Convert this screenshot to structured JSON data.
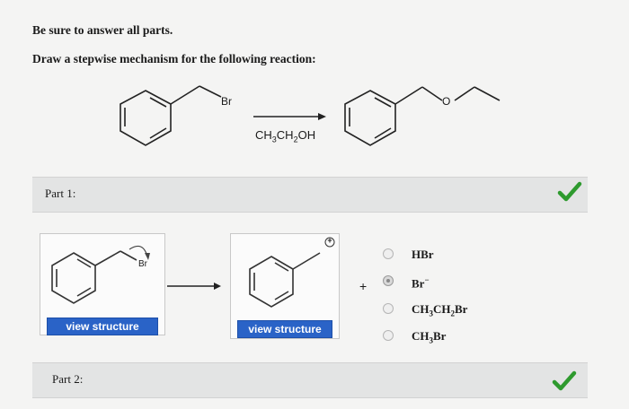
{
  "header": {
    "instruction_1": "Be sure to answer all parts.",
    "instruction_2": "Draw a stepwise mechanism for the following reaction:"
  },
  "reaction": {
    "reactant_label": "Br",
    "reagent": "CH3CH2OH",
    "product_label": "O"
  },
  "part1": {
    "label": "Part 1:",
    "status": "correct",
    "status_color": "#2e9a2e",
    "step1_label": "Br",
    "step1_button": "view structure",
    "step2_charge": "+",
    "step2_button": "view structure",
    "plus_sign": "+",
    "options": [
      {
        "text": "HBr",
        "selected": false
      },
      {
        "text": "Br−",
        "selected": true
      },
      {
        "text": "CH3CH2Br",
        "selected": false
      },
      {
        "text": "CH3Br",
        "selected": false
      }
    ]
  },
  "part2": {
    "label": "Part 2:",
    "status": "correct"
  }
}
